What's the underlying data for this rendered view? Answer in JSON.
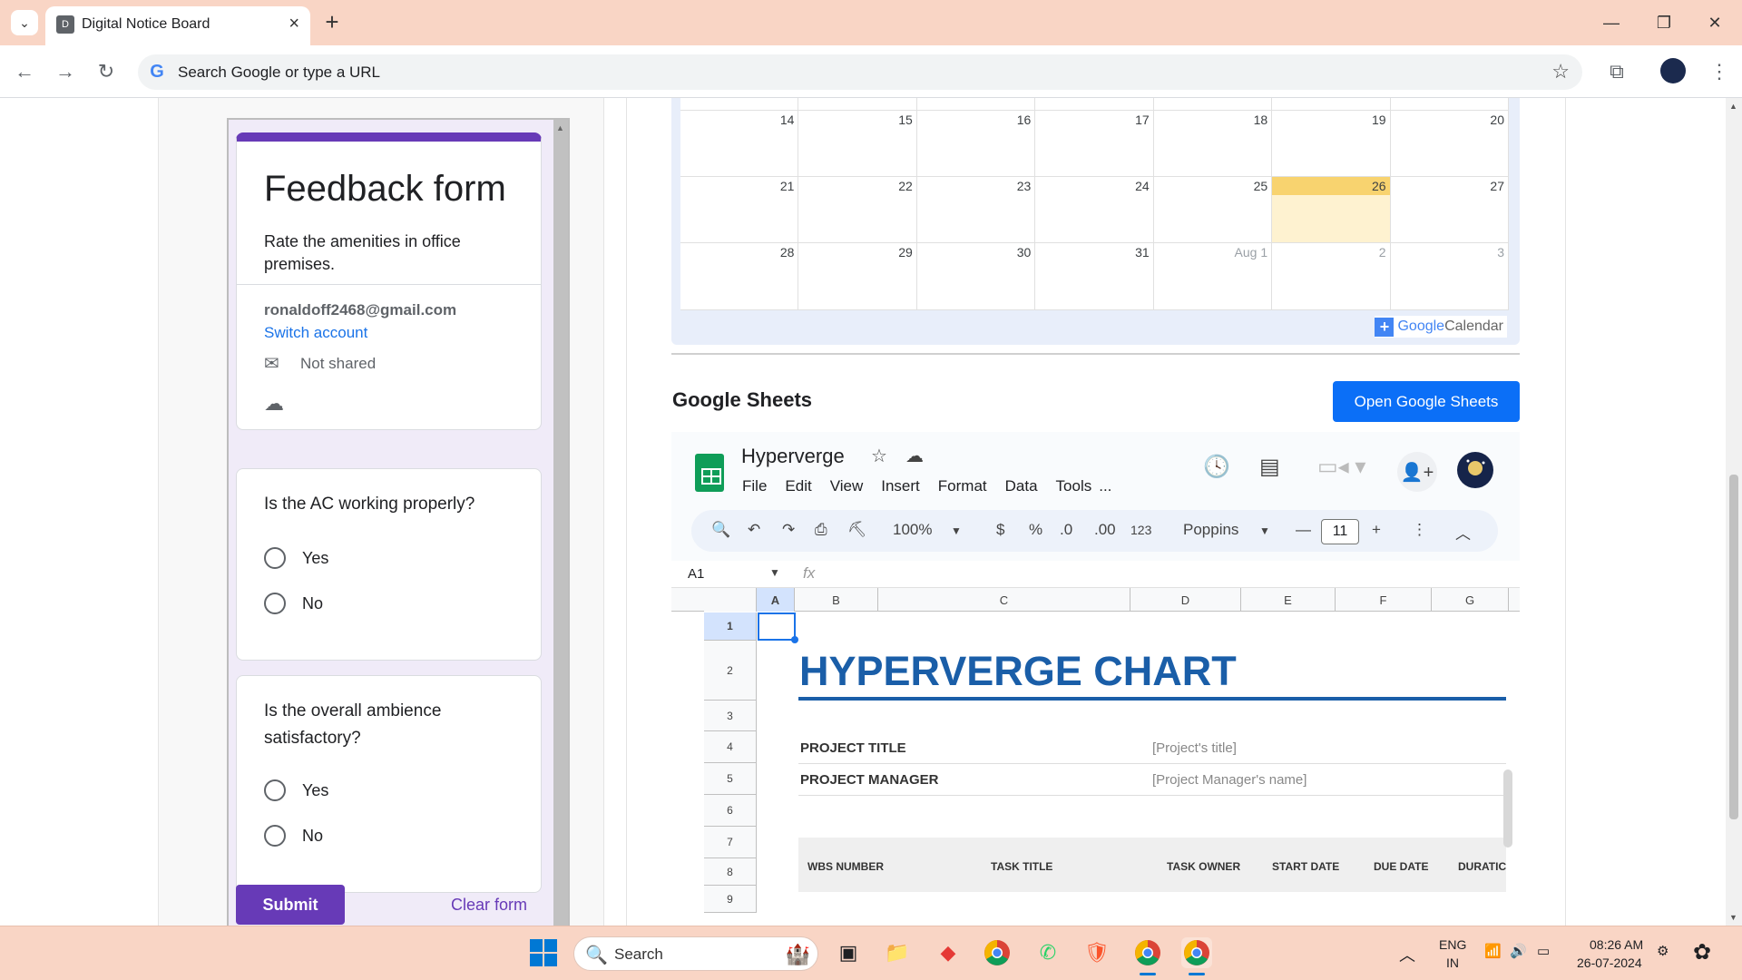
{
  "browser": {
    "tab_title": "Digital Notice Board",
    "tab_favicon": "D",
    "address_placeholder": "Search Google or type a URL"
  },
  "form": {
    "title": "Feedback form",
    "description": "Rate the amenities in office premises.",
    "email": "ronaldoff2468@gmail.com",
    "switch_account": "Switch account",
    "not_shared": "Not shared",
    "questions": [
      {
        "text": "Is the AC working properly?",
        "options": [
          "Yes",
          "No"
        ]
      },
      {
        "text": "Is the overall ambience satisfactory?",
        "options": [
          "Yes",
          "No"
        ]
      }
    ],
    "submit_label": "Submit",
    "clear_label": "Clear form",
    "accent_color": "#673ab7"
  },
  "calendar": {
    "weeks": [
      [
        "14",
        "15",
        "16",
        "17",
        "18",
        "19",
        "20"
      ],
      [
        "21",
        "22",
        "23",
        "24",
        "25",
        "26",
        "27"
      ],
      [
        "28",
        "29",
        "30",
        "31",
        "Aug 1",
        "2",
        "3"
      ]
    ],
    "today": "26",
    "google_word": "Google",
    "calendar_word": "Calendar"
  },
  "sheets_section": {
    "heading": "Google Sheets",
    "open_button": "Open Google Sheets"
  },
  "sheet": {
    "doc_name": "Hyperverge",
    "menu": [
      "File",
      "Edit",
      "View",
      "Insert",
      "Format",
      "Data",
      "Tools",
      "..."
    ],
    "zoom": "100%",
    "currency": "$",
    "percent": "%",
    "dec_less": ".0",
    "dec_more": ".00",
    "number_format": "123",
    "font": "Poppins",
    "font_size": "11",
    "cell_ref": "A1",
    "fx": "fx",
    "columns": [
      "A",
      "B",
      "C",
      "D",
      "E",
      "F",
      "G"
    ],
    "rows": [
      "1",
      "2",
      "3",
      "4",
      "5",
      "6",
      "7",
      "8",
      "9"
    ],
    "chart_title": "HYPERVERGE CHART",
    "project_title_label": "PROJECT TITLE",
    "project_title_value": "[Project's title]",
    "project_manager_label": "PROJECT MANAGER",
    "project_manager_value": "[Project Manager's name]",
    "table_headers": [
      "WBS NUMBER",
      "TASK TITLE",
      "TASK OWNER",
      "START DATE",
      "DUE DATE",
      "DURATIC"
    ],
    "title_color": "#1a5ea8"
  },
  "taskbar": {
    "search_label": "Search",
    "lang_top": "ENG",
    "lang_bottom": "IN",
    "time": "08:26 AM",
    "date": "26-07-2024"
  }
}
